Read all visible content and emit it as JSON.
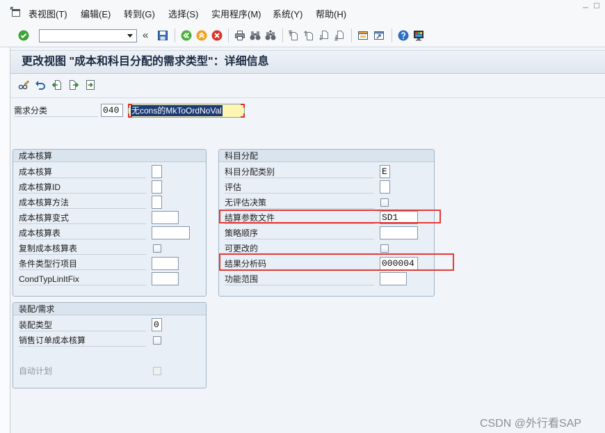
{
  "menu": {
    "items": [
      {
        "label": "表视图(T)"
      },
      {
        "label": "编辑(E)"
      },
      {
        "label": "转到(G)"
      },
      {
        "label": "选择(S)"
      },
      {
        "label": "实用程序(M)"
      },
      {
        "label": "系统(Y)"
      },
      {
        "label": "帮助(H)"
      }
    ]
  },
  "window_controls": {
    "icons": [
      "minimize-icon",
      "maximize-icon"
    ]
  },
  "toolbar": {
    "command_field": {
      "value": ""
    },
    "expand_glyph": "«",
    "icons": [
      "enter-icon",
      "save-icon",
      "back-icon",
      "exit-icon",
      "cancel-icon",
      "print-icon",
      "find-icon",
      "find-next-icon",
      "first-page-icon",
      "previous-page-icon",
      "next-page-icon",
      "last-page-icon",
      "create-session-icon",
      "shortcut-icon",
      "help-icon",
      "customize-layout-icon"
    ]
  },
  "title": "更改视图 \"成本和科目分配的需求类型\"：详细信息",
  "app_toolbar": {
    "icons": [
      "display-change-icon",
      "undo-icon",
      "previous-entry-icon",
      "next-entry-icon",
      "select-entry-icon"
    ]
  },
  "header": {
    "label": "需求分类",
    "code": "040",
    "description": "无cons的MkToOrdNoVal"
  },
  "costing": {
    "title": "成本核算",
    "rows": [
      {
        "label": "成本核算",
        "value": ""
      },
      {
        "label": "成本核算ID",
        "value": ""
      },
      {
        "label": "成本核算方法",
        "value": ""
      },
      {
        "label": "成本核算变式",
        "value": ""
      },
      {
        "label": "成本核算表",
        "value": ""
      },
      {
        "label": "复制成本核算表",
        "checked": false
      },
      {
        "label": "条件类型行项目",
        "value": ""
      },
      {
        "label": "CondTypLinItFix",
        "value": ""
      }
    ]
  },
  "account_assignment": {
    "title": "科目分配",
    "rows": [
      {
        "label": "科目分配类别",
        "value": "E"
      },
      {
        "label": "评估",
        "value": ""
      },
      {
        "label": "无评估决策",
        "checked": false
      },
      {
        "label": "结算参数文件",
        "value": "SD1"
      },
      {
        "label": "策略顺序",
        "value": ""
      },
      {
        "label": "可更改的",
        "checked": false
      },
      {
        "label": "结果分析码",
        "value": "000004"
      },
      {
        "label": "功能范围",
        "value": ""
      }
    ]
  },
  "assembly": {
    "title": "装配/需求",
    "rows": [
      {
        "label": "装配类型",
        "value": "0"
      },
      {
        "label": "销售订单成本核算",
        "checked": false
      },
      {
        "label": "自动计划",
        "checked": false,
        "disabled": true
      }
    ]
  },
  "watermark": "CSDN @外行看SAP",
  "colors": {
    "annotation": "#e53935",
    "selection": "#1c3a74",
    "focus_field": "#fff5b3"
  }
}
